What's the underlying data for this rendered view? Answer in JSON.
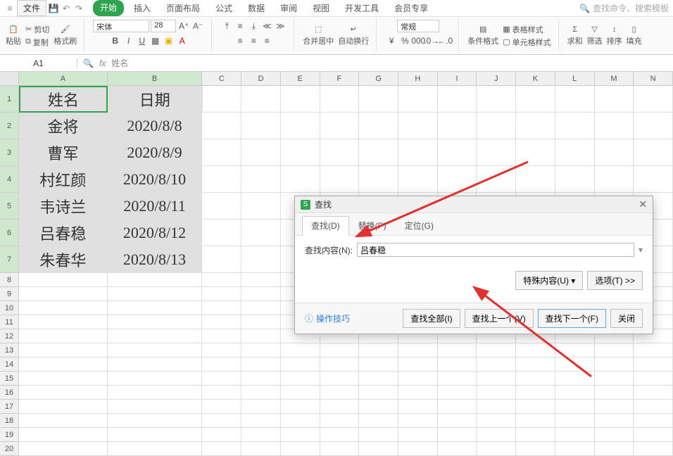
{
  "menubar": {
    "file": "文件",
    "tabs": [
      "开始",
      "插入",
      "页面布局",
      "公式",
      "数据",
      "审阅",
      "视图",
      "开发工具",
      "会员专享"
    ],
    "active_tab_index": 0,
    "search_placeholder": "查找命令、搜索模板"
  },
  "ribbon": {
    "paste": "粘贴",
    "cut": "剪切",
    "copy": "复制",
    "format_painter": "格式刷",
    "font_name": "宋体",
    "font_size": "28",
    "merge_center": "合并居中",
    "auto_wrap": "自动换行",
    "number_format": "常规",
    "cond_format": "条件格式",
    "table_style": "表格样式",
    "cell_style": "单元格样式",
    "sum": "求和",
    "filter": "筛选",
    "sort": "排序",
    "fill": "填充"
  },
  "formula_bar": {
    "name_box": "A1",
    "fx": "fx",
    "content": "姓名"
  },
  "columns": [
    "A",
    "B",
    "C",
    "D",
    "E",
    "F",
    "G",
    "H",
    "I",
    "J",
    "K",
    "L",
    "M",
    "N"
  ],
  "row_numbers": [
    1,
    2,
    3,
    4,
    5,
    6,
    7,
    8,
    9,
    10,
    11,
    12,
    13,
    14,
    15,
    16,
    17,
    18,
    19,
    20
  ],
  "table": {
    "headers": [
      "姓名",
      "日期"
    ],
    "rows": [
      [
        "金将",
        "2020/8/8"
      ],
      [
        "曹军",
        "2020/8/9"
      ],
      [
        "村红颜",
        "2020/8/10"
      ],
      [
        "韦诗兰",
        "2020/8/11"
      ],
      [
        "吕春稳",
        "2020/8/12"
      ],
      [
        "朱春华",
        "2020/8/13"
      ]
    ]
  },
  "dialog": {
    "title": "查找",
    "tabs": [
      "查找(D)",
      "替换(P)",
      "定位(G)"
    ],
    "active_tab_index": 0,
    "content_label": "查找内容(N):",
    "content_value": "吕春稳",
    "special": "特殊内容(U)",
    "options": "选项(T) >>",
    "tips": "操作技巧",
    "find_all": "查找全部(I)",
    "find_prev": "查找上一个(V)",
    "find_next": "查找下一个(F)",
    "close": "关闭"
  }
}
